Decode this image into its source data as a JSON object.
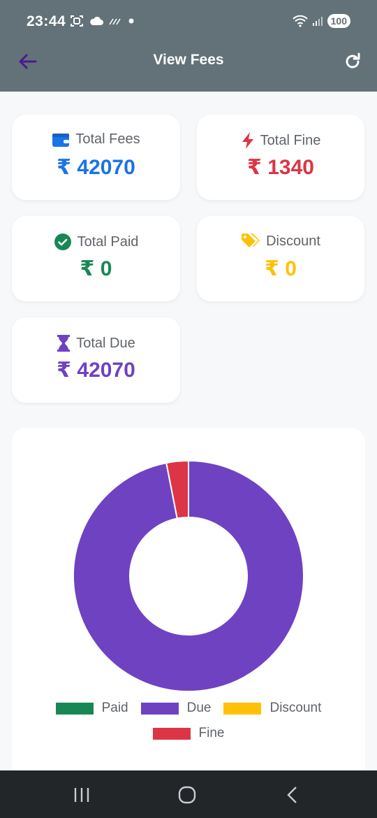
{
  "status_bar": {
    "time": "23:44",
    "battery": "100"
  },
  "header": {
    "title": "View Fees"
  },
  "cards": {
    "total_fees": {
      "label": "Total Fees",
      "value": "₹ 42070",
      "color": "#1a73e8"
    },
    "total_fine": {
      "label": "Total Fine",
      "value": "₹ 1340",
      "color": "#dc3545"
    },
    "total_paid": {
      "label": "Total Paid",
      "value": "₹ 0",
      "color": "#198754"
    },
    "discount": {
      "label": "Discount",
      "value": "₹ 0",
      "color": "#ffc107"
    },
    "total_due": {
      "label": "Total Due",
      "value": "₹ 42070",
      "color": "#6f42c1"
    }
  },
  "chart_data": {
    "type": "pie",
    "variant": "donut",
    "categories": [
      "Paid",
      "Due",
      "Discount",
      "Fine"
    ],
    "values": [
      0,
      42070,
      0,
      1340
    ],
    "colors": [
      "#198754",
      "#6f42c1",
      "#ffc107",
      "#dc3545"
    ],
    "legend_position": "bottom"
  },
  "legend": [
    {
      "label": "Paid",
      "color": "#198754"
    },
    {
      "label": "Due",
      "color": "#6f42c1"
    },
    {
      "label": "Discount",
      "color": "#ffc107"
    },
    {
      "label": "Fine",
      "color": "#dc3545"
    }
  ]
}
